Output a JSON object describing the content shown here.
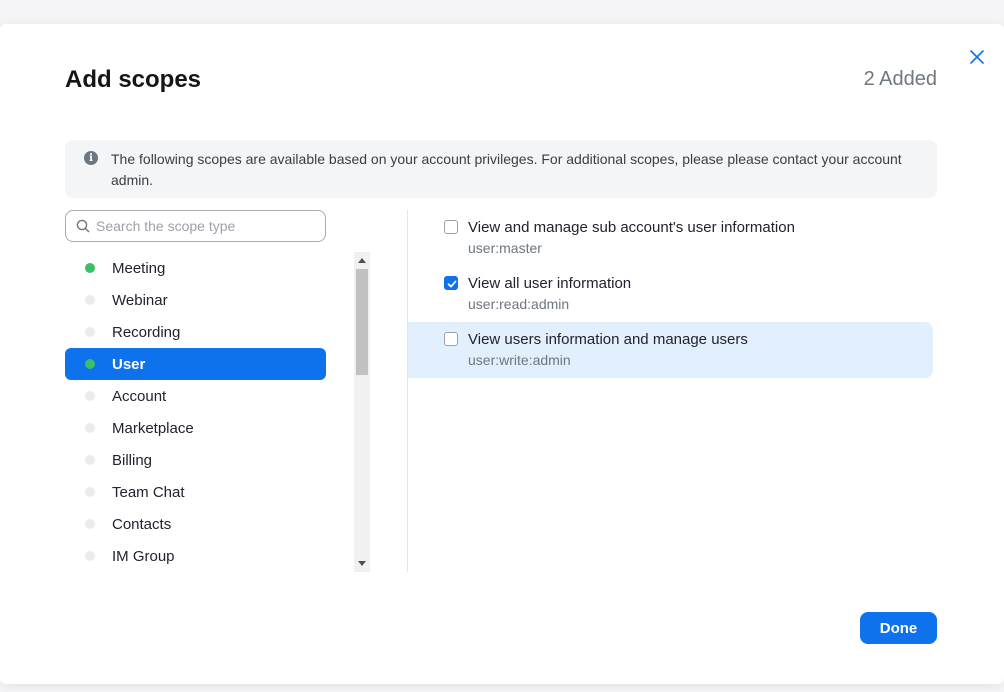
{
  "header": {
    "title": "Add scopes",
    "added_count": "2 Added"
  },
  "info": {
    "text": "The following scopes are available based on your account privileges. For additional scopes, please please contact your account admin."
  },
  "search": {
    "placeholder": "Search the scope type",
    "value": ""
  },
  "categories": [
    {
      "label": "Meeting",
      "has_added": true,
      "selected": false
    },
    {
      "label": "Webinar",
      "has_added": false,
      "selected": false
    },
    {
      "label": "Recording",
      "has_added": false,
      "selected": false
    },
    {
      "label": "User",
      "has_added": true,
      "selected": true
    },
    {
      "label": "Account",
      "has_added": false,
      "selected": false
    },
    {
      "label": "Marketplace",
      "has_added": false,
      "selected": false
    },
    {
      "label": "Billing",
      "has_added": false,
      "selected": false
    },
    {
      "label": "Team Chat",
      "has_added": false,
      "selected": false
    },
    {
      "label": "Contacts",
      "has_added": false,
      "selected": false
    },
    {
      "label": "IM Group",
      "has_added": false,
      "selected": false
    }
  ],
  "scopes": [
    {
      "title": "View and manage sub account's user information",
      "code": "user:master",
      "checked": false,
      "highlighted": false
    },
    {
      "title": "View all user information",
      "code": "user:read:admin",
      "checked": true,
      "highlighted": false
    },
    {
      "title": "View users information and manage users",
      "code": "user:write:admin",
      "checked": false,
      "highlighted": true
    }
  ],
  "footer": {
    "done_label": "Done"
  },
  "colors": {
    "accent": "#0e72ed",
    "added_dot": "#3bc066",
    "highlight_row": "#e1f0fc"
  }
}
